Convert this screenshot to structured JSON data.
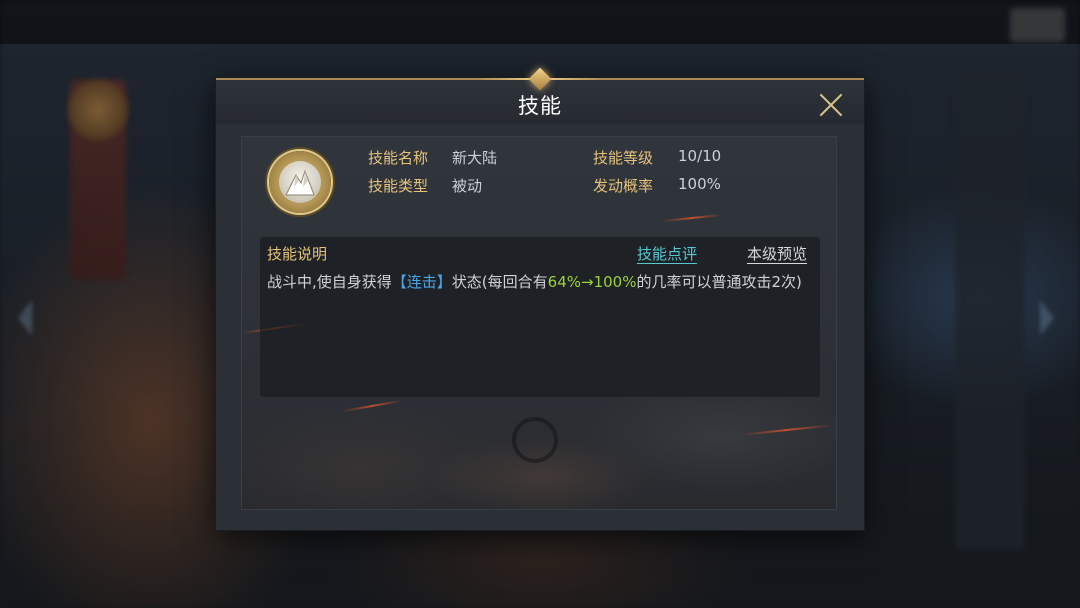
{
  "dialog": {
    "title": "技能",
    "close_icon": "close-x-icon"
  },
  "skill": {
    "icon": "mountain-skill-icon",
    "name_label": "技能名称",
    "name_value": "新大陆",
    "type_label": "技能类型",
    "type_value": "被动",
    "level_label": "技能等级",
    "level_value": "10/10",
    "chance_label": "发动概率",
    "chance_value": "100%"
  },
  "description": {
    "title": "技能说明",
    "review_link": "技能点评",
    "preview_link": "本级预览",
    "text_part1": "战斗中,使自身获得",
    "text_highlight_status": "【连击】",
    "text_part2": "状态(每回合有",
    "text_highlight_rate": "64%→100%",
    "text_part3": "的几率可以普通攻击2次)"
  },
  "colors": {
    "gold_label": "#e6c27a",
    "cyan_link": "#58c8cf",
    "blue_highlight": "#4aa5e8",
    "green_highlight": "#9bd23a"
  }
}
